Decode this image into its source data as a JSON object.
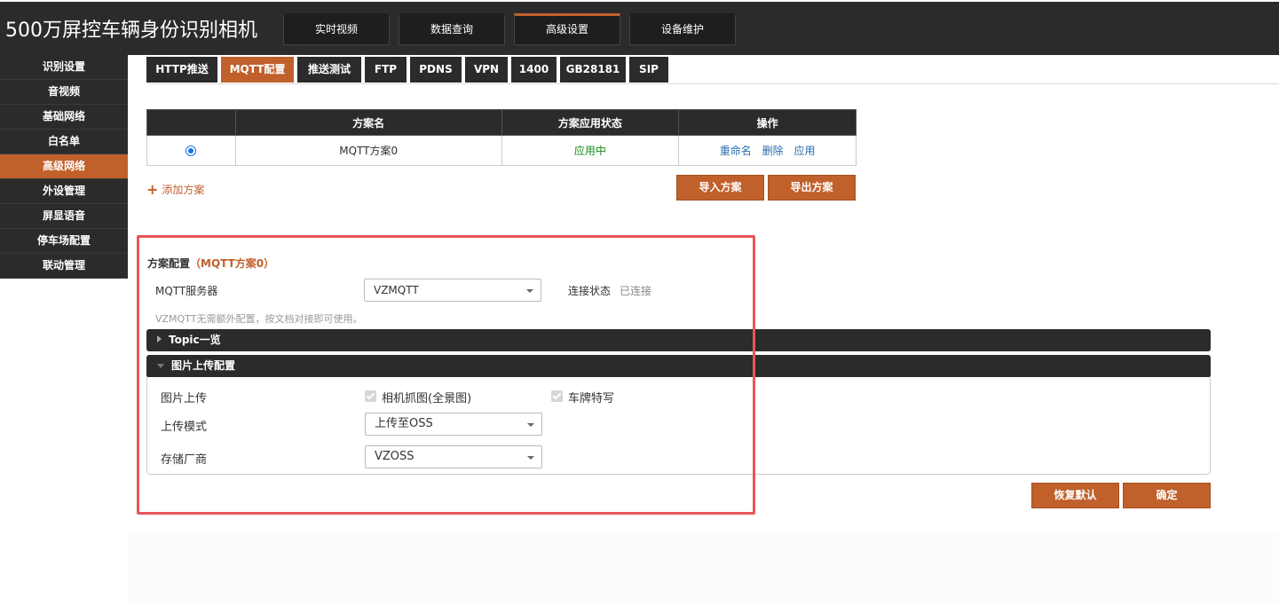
{
  "app": {
    "title": "500万屏控车辆身份识别相机"
  },
  "top_nav": [
    {
      "label": "实时视频"
    },
    {
      "label": "数据查询"
    },
    {
      "label": "高级设置",
      "active": true
    },
    {
      "label": "设备维护"
    }
  ],
  "sidebar": {
    "items": [
      {
        "label": "识别设置"
      },
      {
        "label": "音视频"
      },
      {
        "label": "基础网络"
      },
      {
        "label": "白名单"
      },
      {
        "label": "高级网络",
        "active": true
      },
      {
        "label": "外设管理"
      },
      {
        "label": "屏显语音"
      },
      {
        "label": "停车场配置"
      },
      {
        "label": "联动管理"
      }
    ]
  },
  "sub_tabs": [
    {
      "label": "HTTP推送"
    },
    {
      "label": "MQTT配置",
      "active": true
    },
    {
      "label": "推送测试"
    },
    {
      "label": "FTP"
    },
    {
      "label": "PDNS"
    },
    {
      "label": "VPN"
    },
    {
      "label": "1400"
    },
    {
      "label": "GB28181"
    },
    {
      "label": "SIP"
    }
  ],
  "scheme_table": {
    "headers": [
      "",
      "方案名",
      "方案应用状态",
      "操作"
    ],
    "rows": [
      {
        "selected": true,
        "name": "MQTT方案0",
        "status": "应用中",
        "actions": [
          "重命名",
          "删除",
          "应用"
        ]
      }
    ]
  },
  "add_scheme_label": "添加方案",
  "import_button": "导入方案",
  "export_button": "导出方案",
  "config": {
    "title": "方案配置",
    "scheme_tag": "（MQTT方案0）",
    "mqtt_server_label": "MQTT服务器",
    "mqtt_server_value": "VZMQTT",
    "connection_label": "连接状态",
    "connection_value": "已连接",
    "hint": "VZMQTT无需额外配置，按文档对接即可使用。"
  },
  "topic_panel": {
    "title": "Topic一览",
    "expanded": false
  },
  "upload_panel": {
    "title": "图片上传配置",
    "expanded": true,
    "image_upload_label": "图片上传",
    "checkbox_full": "相机抓图(全景图)",
    "checkbox_plate": "车牌特写",
    "upload_mode_label": "上传模式",
    "upload_mode_value": "上传至OSS",
    "vendor_label": "存储厂商",
    "vendor_value": "VZOSS"
  },
  "restore_button": "恢复默认",
  "confirm_button": "确定",
  "colors": {
    "accent": "#c0602b",
    "dark": "#2b2b2b",
    "highlight": "#e8555a",
    "status_green": "#1a8a1a",
    "link_blue": "#2b6cb0"
  }
}
